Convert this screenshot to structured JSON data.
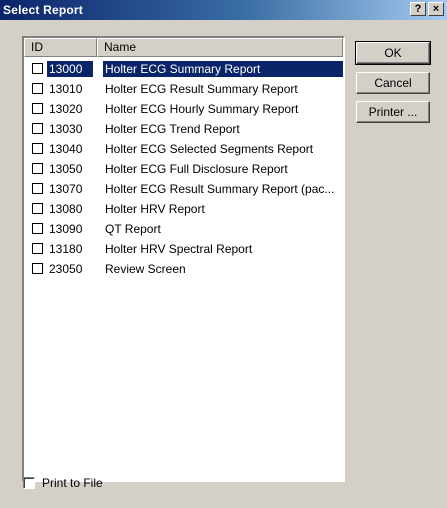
{
  "window": {
    "title": "Select Report",
    "help_label": "?",
    "close_label": "×"
  },
  "list": {
    "columns": {
      "id": "ID",
      "name": "Name"
    },
    "rows": [
      {
        "id": "13000",
        "name": "Holter ECG Summary Report",
        "selected": true,
        "checked": false
      },
      {
        "id": "13010",
        "name": "Holter ECG Result Summary Report",
        "selected": false,
        "checked": false
      },
      {
        "id": "13020",
        "name": "Holter ECG Hourly Summary Report",
        "selected": false,
        "checked": false
      },
      {
        "id": "13030",
        "name": "Holter ECG Trend Report",
        "selected": false,
        "checked": false
      },
      {
        "id": "13040",
        "name": "Holter ECG Selected Segments Report",
        "selected": false,
        "checked": false
      },
      {
        "id": "13050",
        "name": "Holter ECG Full Disclosure Report",
        "selected": false,
        "checked": false
      },
      {
        "id": "13070",
        "name": "Holter ECG Result Summary Report (pac...",
        "selected": false,
        "checked": false
      },
      {
        "id": "13080",
        "name": "Holter HRV Report",
        "selected": false,
        "checked": false
      },
      {
        "id": "13090",
        "name": "QT Report",
        "selected": false,
        "checked": false
      },
      {
        "id": "13180",
        "name": "Holter HRV Spectral Report",
        "selected": false,
        "checked": false
      },
      {
        "id": "23050",
        "name": "Review Screen",
        "selected": false,
        "checked": false
      }
    ]
  },
  "buttons": {
    "ok": "OK",
    "cancel": "Cancel",
    "printer": "Printer ..."
  },
  "print_to_file": {
    "label": "Print to File",
    "checked": false
  }
}
